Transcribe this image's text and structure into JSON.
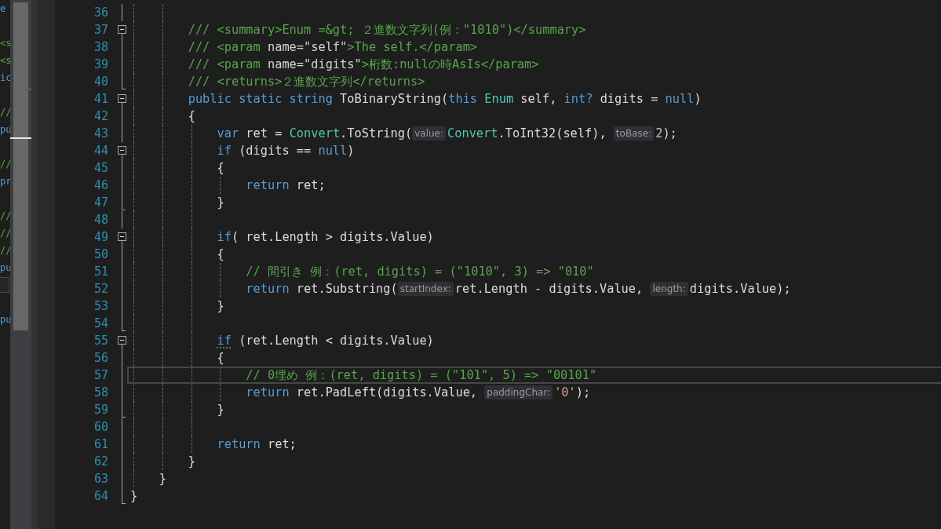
{
  "side_pane": {
    "rows": [
      {
        "kind": "code",
        "text": "e"
      },
      {
        "kind": "blank"
      },
      {
        "kind": "comment",
        "text": "<s"
      },
      {
        "kind": "comment",
        "text": "<s"
      },
      {
        "kind": "code",
        "text": "ic"
      },
      {
        "kind": "blank"
      },
      {
        "kind": "comment",
        "text": "//"
      },
      {
        "kind": "code",
        "text": "pu"
      },
      {
        "kind": "blank"
      },
      {
        "kind": "comment",
        "text": "//"
      },
      {
        "kind": "code",
        "text": "pr"
      },
      {
        "kind": "blank"
      },
      {
        "kind": "comment",
        "text": "//"
      },
      {
        "kind": "comment",
        "text": "//"
      },
      {
        "kind": "comment",
        "text": "//"
      },
      {
        "kind": "code",
        "text": "pu"
      },
      {
        "kind": "box"
      },
      {
        "kind": "blank"
      },
      {
        "kind": "code",
        "text": "pu"
      }
    ]
  },
  "editor": {
    "lines": [
      {
        "number": "36",
        "fold_start": false,
        "fold_end": false,
        "current": false
      },
      {
        "number": "37",
        "fold_start": true,
        "fold_end": false,
        "current": false,
        "tokens": [
          {
            "kind": "comment",
            "text": "        /// <summary>Enum =&gt; ２進数文字列(例：\"1010\")</summary>"
          }
        ]
      },
      {
        "number": "38",
        "fold_start": false,
        "fold_end": false,
        "current": false,
        "tokens": [
          {
            "kind": "comment",
            "text": "        /// <param "
          },
          {
            "kind": "attr",
            "text": "name=\"self\""
          },
          {
            "kind": "comment",
            "text": ">The self.</param>"
          }
        ]
      },
      {
        "number": "39",
        "fold_start": false,
        "fold_end": false,
        "current": false,
        "tokens": [
          {
            "kind": "comment",
            "text": "        /// <param "
          },
          {
            "kind": "attr",
            "text": "name=\"digits\""
          },
          {
            "kind": "comment",
            "text": ">桁数:nullの時AsIs</param>"
          }
        ]
      },
      {
        "number": "40",
        "fold_start": false,
        "fold_end": true,
        "current": false,
        "tokens": [
          {
            "kind": "comment",
            "text": "        /// <returns>２進数文字列</returns>"
          }
        ]
      },
      {
        "number": "41",
        "fold_start": true,
        "fold_end": false,
        "current": false,
        "tokens": [
          {
            "kind": "keyword",
            "text": "        public static string"
          },
          {
            "kind": "plain",
            "text": " ToBinaryString("
          },
          {
            "kind": "keyword",
            "text": "this"
          },
          {
            "kind": "type",
            "text": " Enum"
          },
          {
            "kind": "plain",
            "text": " self, "
          },
          {
            "kind": "keyword",
            "text": "int?"
          },
          {
            "kind": "plain",
            "text": " digits = "
          },
          {
            "kind": "keyword",
            "text": "null"
          },
          {
            "kind": "plain",
            "text": ")"
          }
        ]
      },
      {
        "number": "42",
        "fold_start": false,
        "fold_end": false,
        "current": false,
        "tokens": [
          {
            "kind": "plain",
            "text": "        {"
          }
        ]
      },
      {
        "number": "43",
        "fold_start": false,
        "fold_end": false,
        "current": false,
        "tokens": [
          {
            "kind": "keyword",
            "text": "            var"
          },
          {
            "kind": "plain",
            "text": " ret = "
          },
          {
            "kind": "type",
            "text": "Convert"
          },
          {
            "kind": "plain",
            "text": ".ToString("
          },
          {
            "kind": "hint",
            "text": "value:"
          },
          {
            "kind": "type",
            "text": "Convert"
          },
          {
            "kind": "plain",
            "text": ".ToInt32(self), "
          },
          {
            "kind": "hint",
            "text": "toBase:"
          },
          {
            "kind": "number",
            "text": "2"
          },
          {
            "kind": "plain",
            "text": ");"
          }
        ]
      },
      {
        "number": "44",
        "fold_start": true,
        "fold_end": false,
        "current": false,
        "tokens": [
          {
            "kind": "keyword",
            "text": "            if"
          },
          {
            "kind": "plain",
            "text": " (digits == "
          },
          {
            "kind": "keyword",
            "text": "null"
          },
          {
            "kind": "plain",
            "text": ")"
          }
        ]
      },
      {
        "number": "45",
        "fold_start": false,
        "fold_end": false,
        "current": false,
        "tokens": [
          {
            "kind": "plain",
            "text": "            {"
          }
        ]
      },
      {
        "number": "46",
        "fold_start": false,
        "fold_end": false,
        "current": false,
        "tokens": [
          {
            "kind": "keyword",
            "text": "                return"
          },
          {
            "kind": "plain",
            "text": " ret;"
          }
        ]
      },
      {
        "number": "47",
        "fold_start": false,
        "fold_end": true,
        "current": false,
        "tokens": [
          {
            "kind": "plain",
            "text": "            }"
          }
        ]
      },
      {
        "number": "48",
        "fold_start": false,
        "fold_end": false,
        "current": false
      },
      {
        "number": "49",
        "fold_start": true,
        "fold_end": false,
        "current": false,
        "tokens": [
          {
            "kind": "keyword",
            "text": "            if"
          },
          {
            "kind": "plain",
            "text": "( ret.Length > digits.Value)"
          }
        ]
      },
      {
        "number": "50",
        "fold_start": false,
        "fold_end": false,
        "current": false,
        "tokens": [
          {
            "kind": "plain",
            "text": "            {"
          }
        ]
      },
      {
        "number": "51",
        "fold_start": false,
        "fold_end": false,
        "current": false,
        "tokens": [
          {
            "kind": "comment",
            "text": "                // 間引き 例：(ret, digits) = (\"1010\", 3) => \"010\""
          }
        ]
      },
      {
        "number": "52",
        "fold_start": false,
        "fold_end": false,
        "current": false,
        "tokens": [
          {
            "kind": "keyword",
            "text": "                return"
          },
          {
            "kind": "plain",
            "text": " ret.Substring("
          },
          {
            "kind": "hint",
            "text": "startIndex:"
          },
          {
            "kind": "plain",
            "text": "ret.Length - digits.Value, "
          },
          {
            "kind": "hint",
            "text": "length:"
          },
          {
            "kind": "plain",
            "text": "digits.Value);"
          }
        ]
      },
      {
        "number": "53",
        "fold_start": false,
        "fold_end": false,
        "current": false,
        "tokens": [
          {
            "kind": "plain",
            "text": "            }"
          }
        ]
      },
      {
        "number": "54",
        "fold_start": false,
        "fold_end": true,
        "current": false
      },
      {
        "number": "55",
        "fold_start": true,
        "fold_end": false,
        "current": false,
        "tokens": [
          {
            "kind": "keyword",
            "text": "            if",
            "squiggle": true
          },
          {
            "kind": "plain",
            "text": " (ret.Length < digits.Value)"
          }
        ]
      },
      {
        "number": "56",
        "fold_start": false,
        "fold_end": false,
        "current": false,
        "tokens": [
          {
            "kind": "plain",
            "text": "            {"
          }
        ]
      },
      {
        "number": "57",
        "fold_start": false,
        "fold_end": false,
        "current": true,
        "tokens": [
          {
            "kind": "comment",
            "text": "                // 0埋め 例：(ret, digits) = (\"101\", 5) => \"00101\""
          }
        ]
      },
      {
        "number": "58",
        "fold_start": false,
        "fold_end": false,
        "current": false,
        "tokens": [
          {
            "kind": "keyword",
            "text": "                return"
          },
          {
            "kind": "plain",
            "text": " ret.PadLeft(digits.Value, "
          },
          {
            "kind": "hint",
            "text": "paddingChar:"
          },
          {
            "kind": "string",
            "text": "'0'"
          },
          {
            "kind": "plain",
            "text": ");"
          }
        ]
      },
      {
        "number": "59",
        "fold_start": false,
        "fold_end": true,
        "current": false,
        "tokens": [
          {
            "kind": "plain",
            "text": "            }"
          }
        ]
      },
      {
        "number": "60",
        "fold_start": false,
        "fold_end": false,
        "current": false
      },
      {
        "number": "61",
        "fold_start": false,
        "fold_end": false,
        "current": false,
        "tokens": [
          {
            "kind": "keyword",
            "text": "            return"
          },
          {
            "kind": "plain",
            "text": " ret;"
          }
        ]
      },
      {
        "number": "62",
        "fold_start": false,
        "fold_end": false,
        "current": false,
        "tokens": [
          {
            "kind": "plain",
            "text": "        }"
          }
        ]
      },
      {
        "number": "63",
        "fold_start": false,
        "fold_end": false,
        "current": false,
        "tokens": [
          {
            "kind": "plain",
            "text": "    }"
          }
        ]
      },
      {
        "number": "64",
        "fold_start": false,
        "fold_end": true,
        "current": false,
        "tokens": [
          {
            "kind": "plain",
            "text": "}"
          }
        ]
      }
    ]
  }
}
